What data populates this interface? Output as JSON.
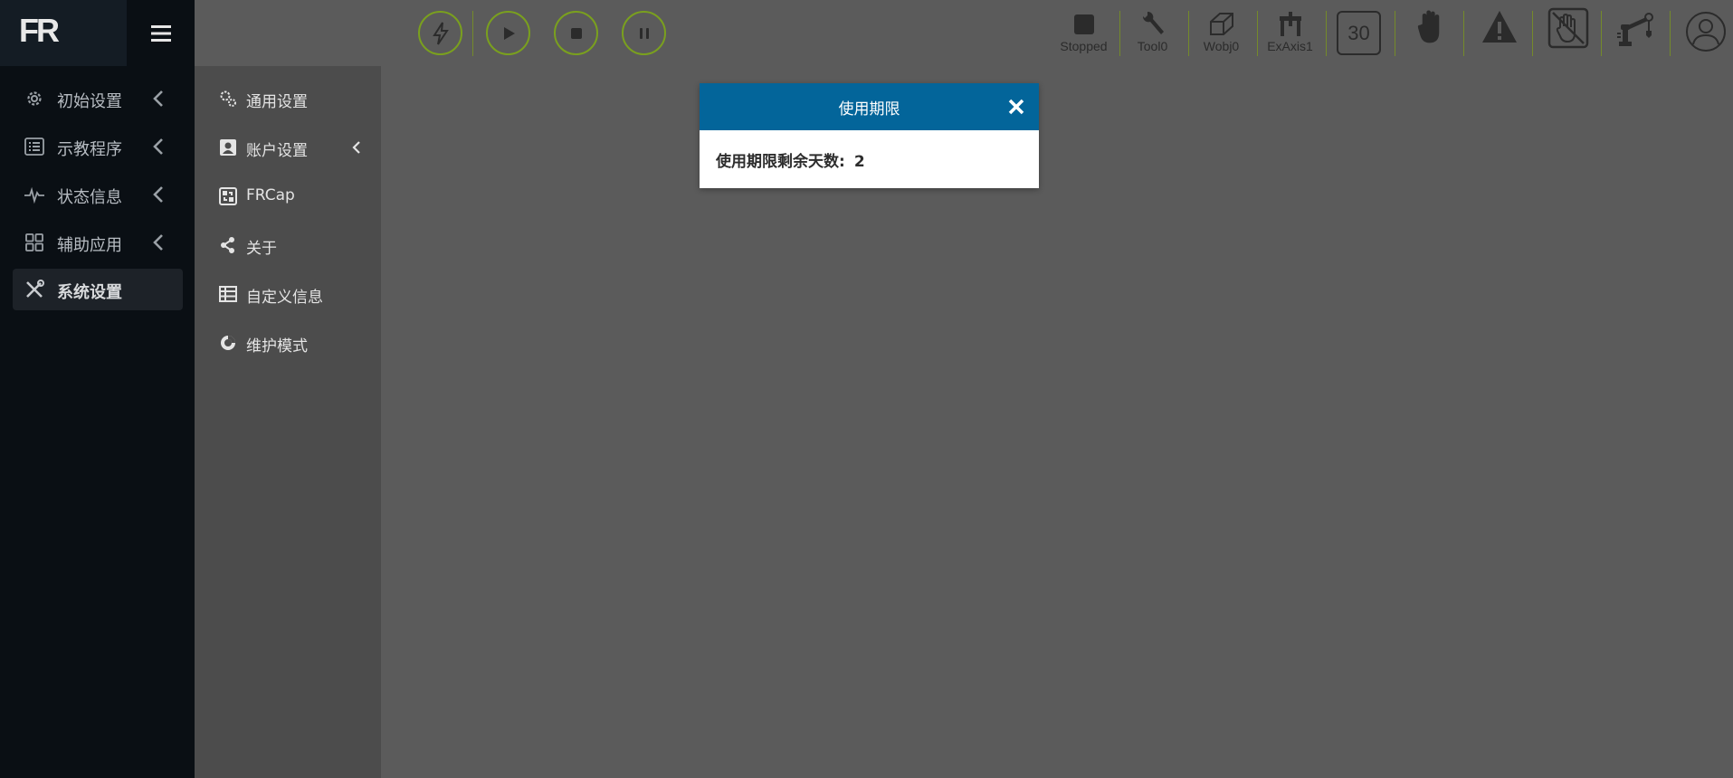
{
  "logo": "FR",
  "nav": [
    {
      "label": "初始设置",
      "icon": "gear-icon"
    },
    {
      "label": "示教程序",
      "icon": "list-icon"
    },
    {
      "label": "状态信息",
      "icon": "pulse-icon"
    },
    {
      "label": "辅助应用",
      "icon": "grid-icon"
    },
    {
      "label": "系统设置",
      "icon": "tools-icon",
      "active": true
    }
  ],
  "submenu": [
    {
      "label": "通用设置",
      "icon": "gears-icon"
    },
    {
      "label": "账户设置",
      "icon": "account-icon"
    },
    {
      "label": "FRCap",
      "icon": "plugin-icon"
    },
    {
      "label": "关于",
      "icon": "share-icon"
    },
    {
      "label": "自定义信息",
      "icon": "table-icon"
    },
    {
      "label": "维护模式",
      "icon": "maintenance-icon"
    }
  ],
  "status": {
    "state": "Stopped",
    "tool": "Tool0",
    "wobj": "Wobj0",
    "exaxis": "ExAxis1",
    "speed": "30"
  },
  "modal": {
    "title": "使用期限",
    "label": "使用期限剩余天数:",
    "value": "2"
  },
  "colors": {
    "accent_green": "#7aa01e",
    "modal_header": "#03659a",
    "sidebar_bg": "#0a0f14"
  }
}
